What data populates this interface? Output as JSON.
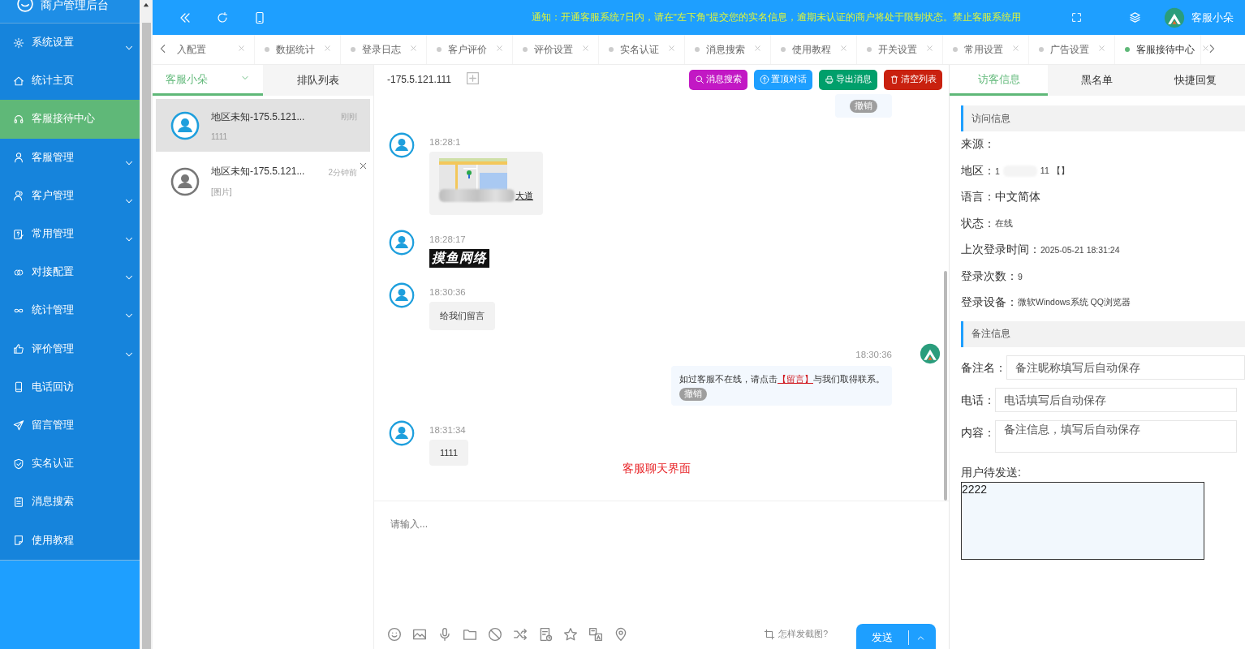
{
  "sidebar": {
    "title": "商户管理后台",
    "items": [
      {
        "label": "系统设置",
        "expandable": true,
        "selected": false
      },
      {
        "label": "统计主页",
        "expandable": false,
        "selected": false
      },
      {
        "label": "客服接待中心",
        "expandable": false,
        "selected": true
      },
      {
        "label": "客服管理",
        "expandable": true,
        "selected": false
      },
      {
        "label": "客户管理",
        "expandable": true,
        "selected": false
      },
      {
        "label": "常用管理",
        "expandable": true,
        "selected": false
      },
      {
        "label": "对接配置",
        "expandable": true,
        "selected": false
      },
      {
        "label": "统计管理",
        "expandable": true,
        "selected": false
      },
      {
        "label": "评价管理",
        "expandable": true,
        "selected": false
      },
      {
        "label": "电话回访",
        "expandable": false,
        "selected": false
      },
      {
        "label": "留言管理",
        "expandable": false,
        "selected": false
      },
      {
        "label": "实名认证",
        "expandable": false,
        "selected": false
      },
      {
        "label": "消息搜索",
        "expandable": false,
        "selected": false
      },
      {
        "label": "使用教程",
        "expandable": false,
        "selected": false
      }
    ]
  },
  "header": {
    "notice": "通知：开通客服系统7日内，请在\"左下角\"提交您的实名信息，逾期未认证的商户将处于限制状态。禁止客服系统用",
    "user": "客服小朵"
  },
  "tabs": [
    {
      "label": "入配置",
      "dot": false,
      "selected": false
    },
    {
      "label": "数据统计",
      "dot": true,
      "selected": false
    },
    {
      "label": "登录日志",
      "dot": true,
      "selected": false
    },
    {
      "label": "客户评价",
      "dot": true,
      "selected": false
    },
    {
      "label": "评价设置",
      "dot": true,
      "selected": false
    },
    {
      "label": "实名认证",
      "dot": true,
      "selected": false
    },
    {
      "label": "消息搜索",
      "dot": true,
      "selected": false
    },
    {
      "label": "使用教程",
      "dot": true,
      "selected": false
    },
    {
      "label": "开关设置",
      "dot": true,
      "selected": false
    },
    {
      "label": "常用设置",
      "dot": true,
      "selected": false
    },
    {
      "label": "广告设置",
      "dot": true,
      "selected": false
    },
    {
      "label": "客服接待中心",
      "dot": true,
      "selected": true
    }
  ],
  "visitor_list": {
    "tabs": [
      {
        "label": "客服小朵",
        "dropdown": true,
        "selected": true
      },
      {
        "label": "排队列表",
        "dropdown": false,
        "selected": false
      }
    ],
    "items": [
      {
        "name": "地区未知-175.5.121...",
        "preview": "1111",
        "time": "刚刚",
        "online": true,
        "closable": false,
        "selected": true
      },
      {
        "name": "地区未知-175.5.121...",
        "preview": "[图片]",
        "time": "2分钟前",
        "online": false,
        "closable": true,
        "selected": false
      }
    ]
  },
  "chat": {
    "title": "-175.5.121.111",
    "actions": [
      {
        "label": "消息搜索",
        "kind": "search",
        "color": "#c218c4"
      },
      {
        "label": "置顶对话",
        "kind": "pin",
        "color": "#1e9fff"
      },
      {
        "label": "导出消息",
        "kind": "export",
        "color": "#009f6b"
      },
      {
        "label": "清空列表",
        "kind": "clear",
        "color": "#c9210f"
      }
    ],
    "messages": [
      {
        "kind": "revoke_only",
        "outgoing": true,
        "revoke": "撤销"
      },
      {
        "kind": "map",
        "outgoing": false,
        "time": "18:28:1",
        "address": "大道"
      },
      {
        "kind": "sticker",
        "outgoing": false,
        "time": "18:28:17",
        "text": "摸鱼网络"
      },
      {
        "kind": "text",
        "outgoing": false,
        "time": "18:30:36",
        "text": "给我们留言"
      },
      {
        "kind": "link_text",
        "outgoing": true,
        "time": "18:30:36",
        "text_before": "如过客服不在线，请点击",
        "link": "【留言】",
        "text_after": "与我们取得联系。",
        "revoke": "撤销"
      },
      {
        "kind": "text",
        "outgoing": false,
        "time": "18:31:34",
        "text": "1111"
      }
    ],
    "caption": "客服聊天界面",
    "input_placeholder": "请输入...",
    "screenshot_help": "怎样发截图?",
    "send": "发送"
  },
  "visitor_info": {
    "tabs": [
      {
        "label": "访客信息",
        "selected": true
      },
      {
        "label": "黑名单",
        "selected": false
      },
      {
        "label": "快捷回复",
        "selected": false
      }
    ],
    "visit_title": "访问信息",
    "rows": [
      {
        "label": "来源："
      },
      {
        "label": "地区：",
        "value": "1",
        "redacted": true,
        "value_after": "11 【】"
      },
      {
        "label": "语言：",
        "value": "中文简体",
        "emphasis": true
      },
      {
        "label": "状态：",
        "value": "在线"
      },
      {
        "label": "上次登录时间：",
        "value": "2025-05-21 18:31:24"
      },
      {
        "label": "登录次数：",
        "value": "9"
      },
      {
        "label": "登录设备：",
        "value": "微软Windows系统 QQ浏览器"
      }
    ],
    "notes_title": "备注信息",
    "fields": [
      {
        "label": "备注名：",
        "placeholder": "备注昵称填写后自动保存",
        "kind": "input"
      },
      {
        "label": "电话：",
        "placeholder": "电话填写后自动保存",
        "kind": "input"
      },
      {
        "label": "内容：",
        "placeholder": "备注信息，填写后自动保存",
        "kind": "textarea"
      }
    ],
    "pending_label": "用户待发送:",
    "pending_value": "2222"
  }
}
